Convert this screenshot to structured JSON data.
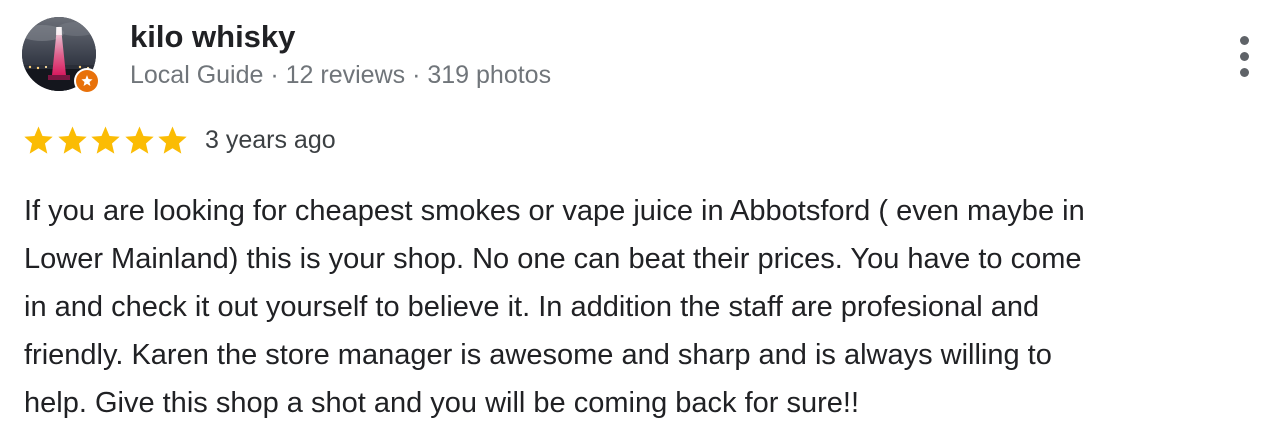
{
  "review": {
    "author": {
      "name": "kilo whisky",
      "meta": "Local Guide · 12 reviews · 319 photos",
      "avatar_icon": "profile-photo-night-fountain",
      "badge_icon": "local-guide-star-icon",
      "badge_color": "#e8710a"
    },
    "rating": {
      "stars": 5,
      "max": 5,
      "star_color": "#fbbc04"
    },
    "time": "3 years ago",
    "text_lines": [
      "If you are looking for cheapest smokes or vape juice in Abbotsford ( even maybe in",
      "Lower Mainland) this is your shop. No one can beat their prices. You have to come",
      "in and check it out yourself to believe it. In addition the staff are profesional and",
      "friendly. Karen the store manager is awesome and sharp and is always willing to",
      "help. Give this shop a shot and you will be coming back for sure!!"
    ],
    "menu_icon": "more-vert-icon"
  }
}
